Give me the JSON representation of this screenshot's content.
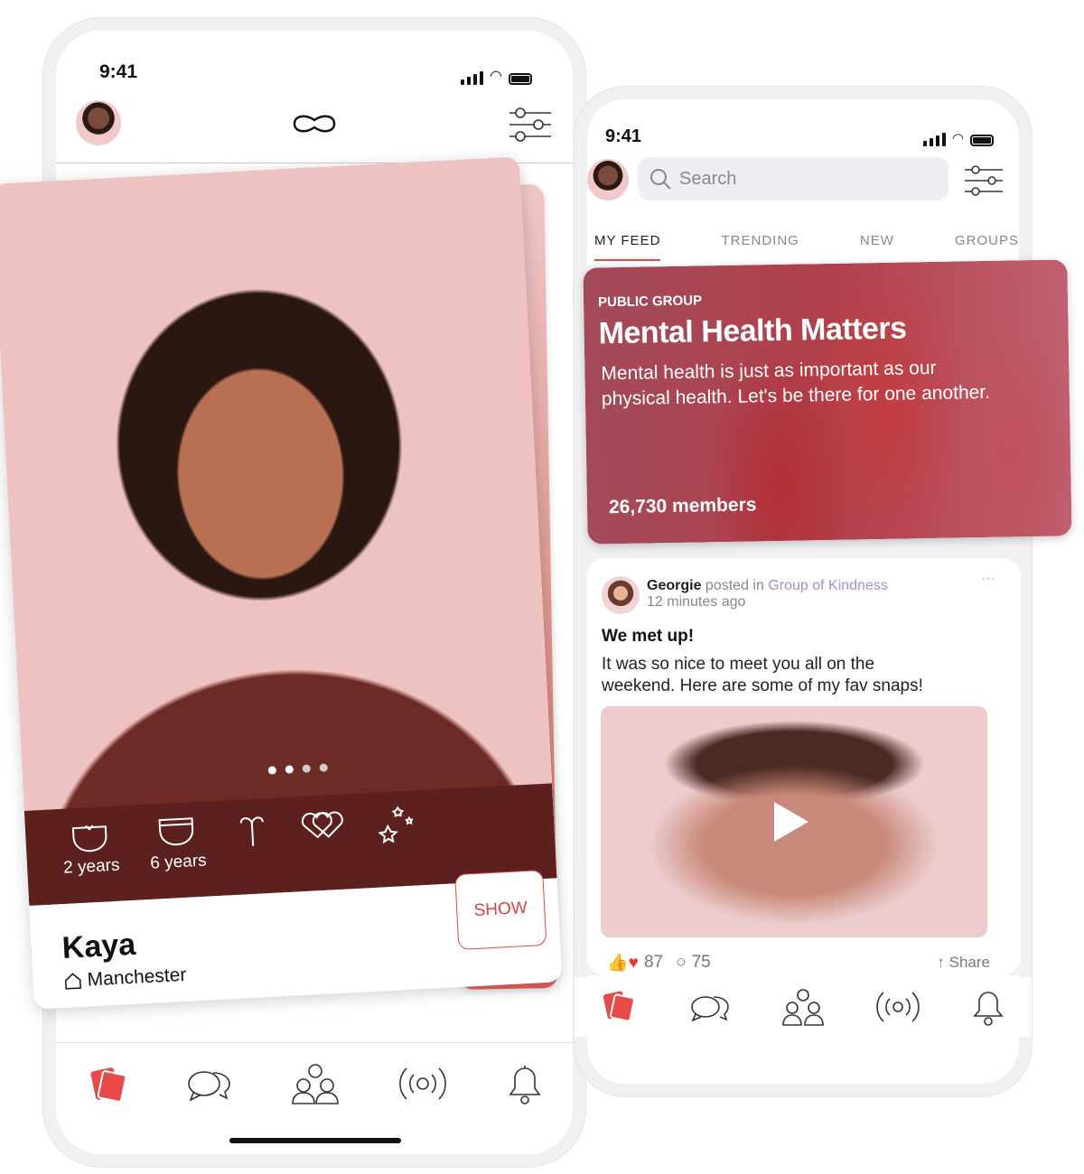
{
  "left_phone": {
    "status_time": "9:41",
    "profile_card": {
      "name": "Kaya",
      "location": "Manchester",
      "show_button": "SHOW",
      "photo_dots": 4,
      "active_dot": 1,
      "stats": [
        {
          "icon": "kids-diaper-bow-icon",
          "label": "2 years"
        },
        {
          "icon": "diaper-icon",
          "label": "6 years"
        },
        {
          "icon": "aries-icon",
          "label": ""
        },
        {
          "icon": "hearts-icon",
          "label": ""
        },
        {
          "icon": "stars-icon",
          "label": ""
        }
      ]
    },
    "nav": [
      "cards-icon",
      "chat-icon",
      "community-icon",
      "live-icon",
      "bell-icon"
    ]
  },
  "right_phone": {
    "status_time": "9:41",
    "search": {
      "placeholder": "Search"
    },
    "tabs": [
      "MY FEED",
      "TRENDING",
      "NEW",
      "GROUPS"
    ],
    "active_tab": "MY FEED",
    "group": {
      "type": "PUBLIC GROUP",
      "title": "Mental Health Matters",
      "description": "Mental health is just as important as our physical health. Let's be there for one another.",
      "members": "26,730 members"
    },
    "post": {
      "author": "Georgie",
      "posted_in": "posted in",
      "group": "Group of Kindness",
      "time": "12 minutes ago",
      "title": "We met up!",
      "body": "It was so nice to meet you all on the weekend. Here are some of my fav snaps!",
      "reactions": "87",
      "comments": "75",
      "share": "Share"
    },
    "colors": {
      "accent": "#e04848",
      "group_link": "#a98ac9",
      "banner": "#a9434f"
    }
  }
}
